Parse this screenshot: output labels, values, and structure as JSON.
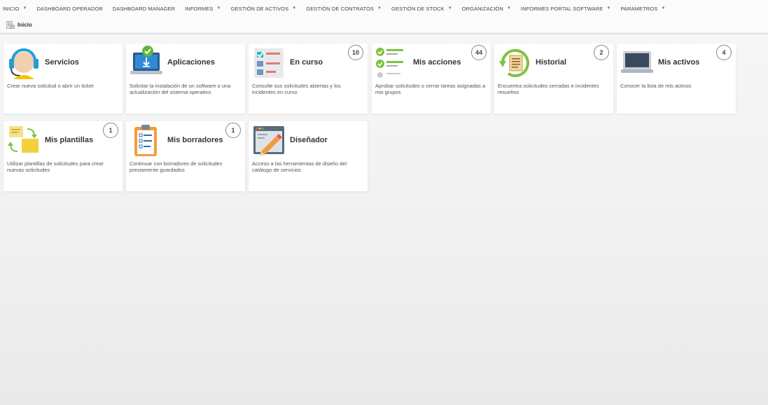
{
  "nav": {
    "items": [
      {
        "label": "INICIO",
        "caret": true
      },
      {
        "label": "DASHBOARD OPERADOR",
        "caret": false
      },
      {
        "label": "DASHBOARD MANAGER",
        "caret": false
      },
      {
        "label": "INFORMES",
        "caret": true
      },
      {
        "label": "GESTIÓN DE ACTIVOS",
        "caret": true
      },
      {
        "label": "GESTIÓN DE CONTRATOS",
        "caret": true
      },
      {
        "label": "GESTIÓN DE STOCK",
        "caret": true
      },
      {
        "label": "ORGANIZACIÓN",
        "caret": true
      },
      {
        "label": "INFORMES PORTAL SOFTWARE",
        "caret": true
      },
      {
        "label": "PARAMETROS",
        "caret": true
      }
    ],
    "caret_glyph": "▼"
  },
  "breadcrumb": {
    "label": "Inicio",
    "icon": "home-page-icon"
  },
  "tiles": [
    {
      "title": "Servicios",
      "desc": "Crear nueva solicitud o abrir un ticket",
      "badge": null,
      "icon": "headset-icon"
    },
    {
      "title": "Aplicaciones",
      "desc": "Solicitar la instalación de un software o una actualización del sistema operativo",
      "badge": null,
      "icon": "laptop-download-icon"
    },
    {
      "title": "En curso",
      "desc": "Consulte sus solicitudes abiertas y los incidentes en curso",
      "badge": "10",
      "icon": "checklist-document-icon"
    },
    {
      "title": "Mis acciones",
      "desc": "Aprobar solicitudes o cerrar tareas asignadas a mis grupos",
      "badge": "44",
      "icon": "check-list-icon"
    },
    {
      "title": "Historial",
      "desc": "Encuentra solicitudes cerradas e incidentes resueltos",
      "badge": "2",
      "icon": "history-icon"
    },
    {
      "title": "Mis activos",
      "desc": "Conocer la lista de mis activos",
      "badge": "4",
      "icon": "monitor-icon"
    },
    {
      "title": "Mis plantillas",
      "desc": "Utilizar plantillas de solicitudes para crear nuevas solicitudes",
      "badge": "1",
      "icon": "templates-icon"
    },
    {
      "title": "Mis borradores",
      "desc": "Continuar con borradores de solicitudes previamente guardados",
      "badge": "1",
      "icon": "clipboard-icon"
    },
    {
      "title": "Diseñador",
      "desc": "Acceso a las herramientas de diseño del catálogo de servicios",
      "badge": null,
      "icon": "designer-pencil-icon"
    }
  ]
}
